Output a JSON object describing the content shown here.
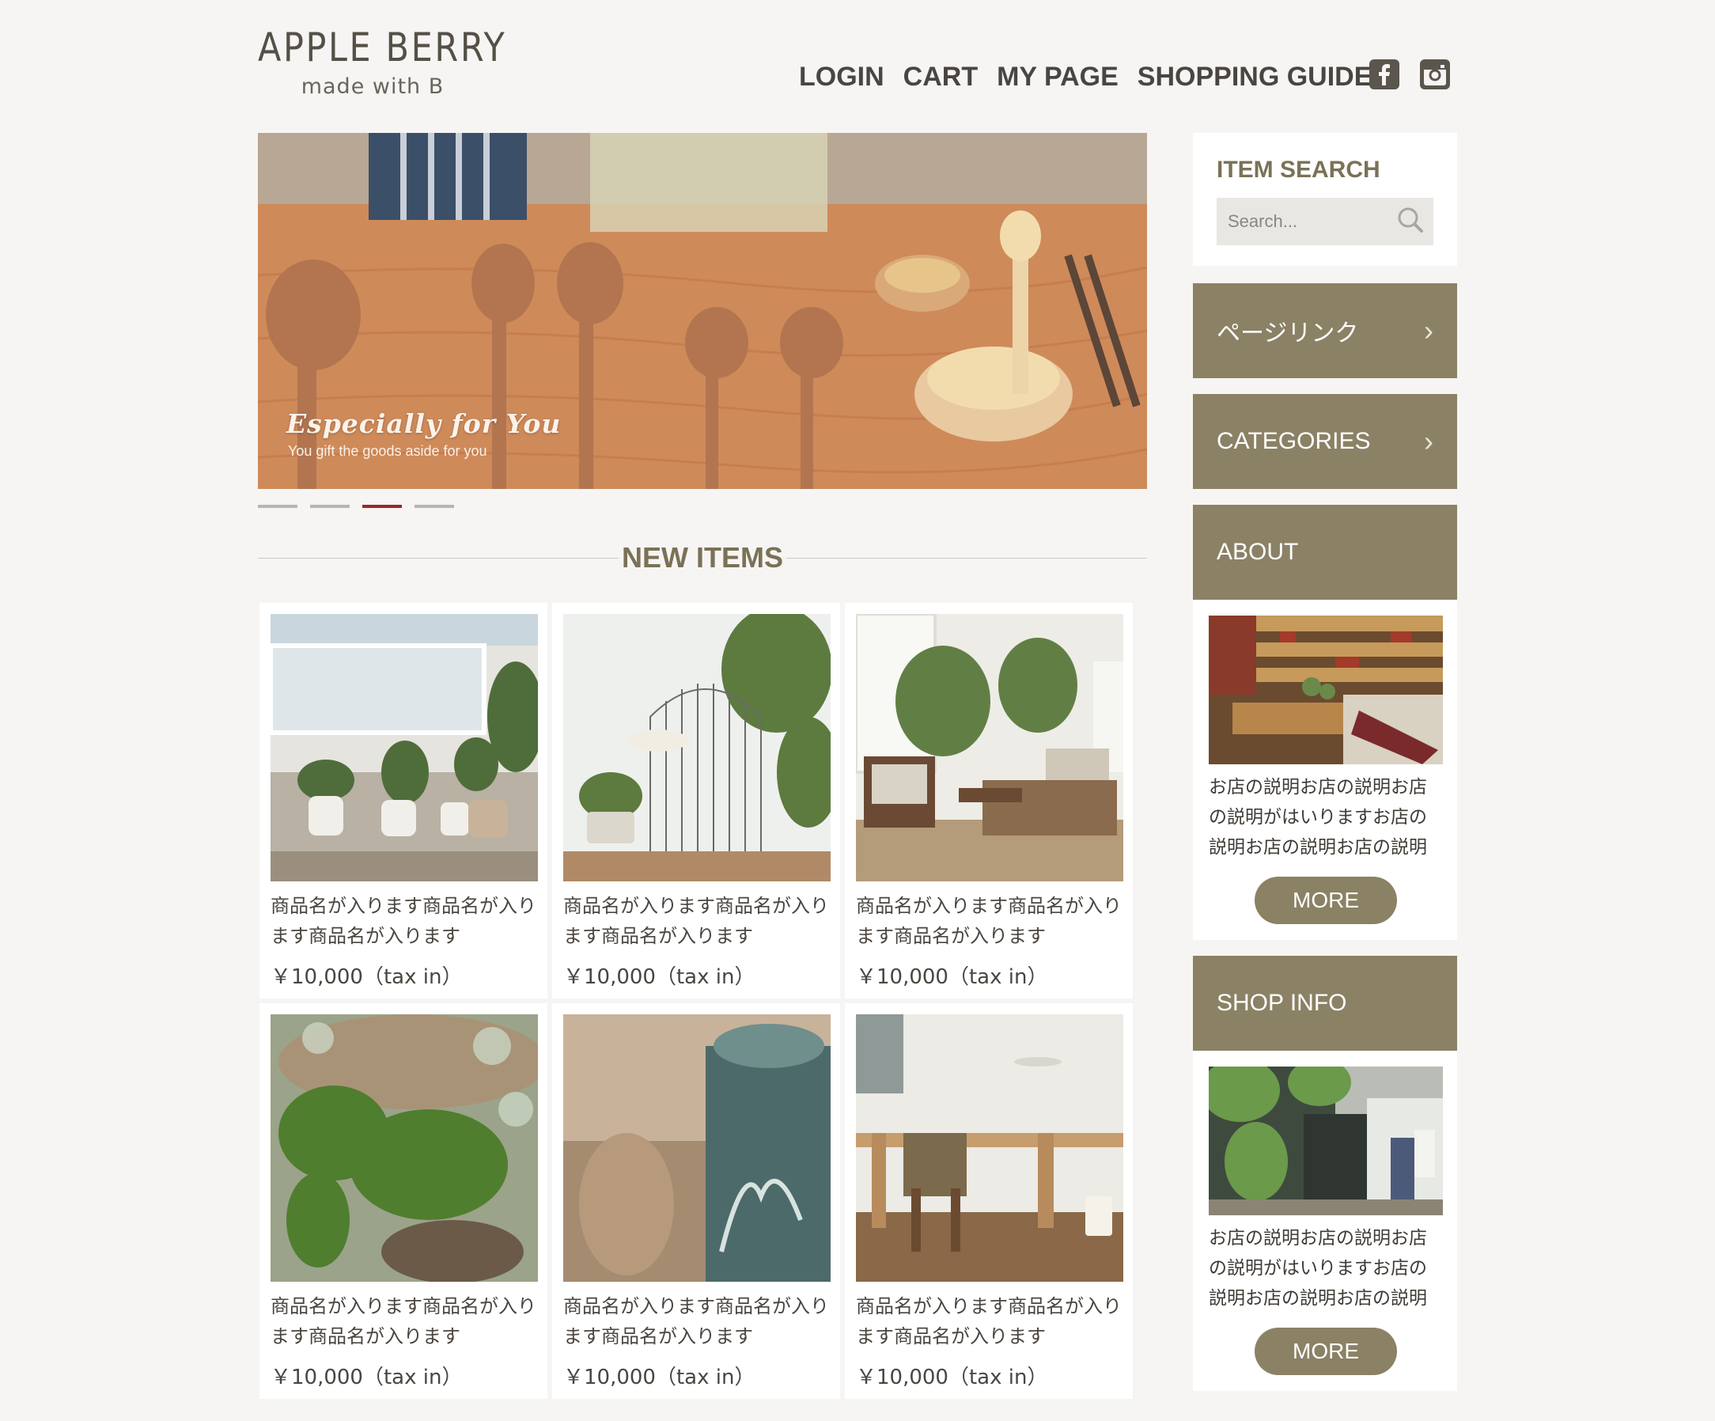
{
  "header": {
    "logo_title": "APPLE BERRY",
    "logo_sub": "made with B",
    "nav": [
      "LOGIN",
      "CART",
      "MY PAGE",
      "SHOPPING GUIDE"
    ]
  },
  "hero": {
    "title": "Especially for You",
    "subtitle": "You gift the goods aside for you",
    "slides": 4,
    "active_slide": 3
  },
  "new_items": {
    "title": "NEW ITEMS",
    "products": [
      {
        "name": "商品名が入ります商品名が入ります商品名が入ります",
        "price": "￥10,000（tax in）"
      },
      {
        "name": "商品名が入ります商品名が入ります商品名が入ります",
        "price": "￥10,000（tax in）"
      },
      {
        "name": "商品名が入ります商品名が入ります商品名が入ります",
        "price": "￥10,000（tax in）"
      },
      {
        "name": "商品名が入ります商品名が入ります商品名が入ります",
        "price": "￥10,000（tax in）"
      },
      {
        "name": "商品名が入ります商品名が入ります商品名が入ります",
        "price": "￥10,000（tax in）"
      },
      {
        "name": "商品名が入ります商品名が入ります商品名が入ります",
        "price": "￥10,000（tax in）"
      }
    ]
  },
  "sidebar": {
    "search_title": "ITEM SEARCH",
    "search_placeholder": "Search...",
    "page_link": "ページリンク",
    "categories": "CATEGORIES",
    "about_title": "ABOUT",
    "about_desc": "お店の説明お店の説明お店の説明がはいりますお店の説明お店の説明お店の説明",
    "about_more": "MORE",
    "shop_title": "SHOP INFO",
    "shop_desc": "お店の説明お店の説明お店の説明がはいりますお店の説明お店の説明お店の説明",
    "shop_more": "MORE"
  },
  "colors": {
    "accent": "#8b8165",
    "title": "#7a7157",
    "active_dot": "#9a2a22",
    "background": "#f6f5f3"
  }
}
